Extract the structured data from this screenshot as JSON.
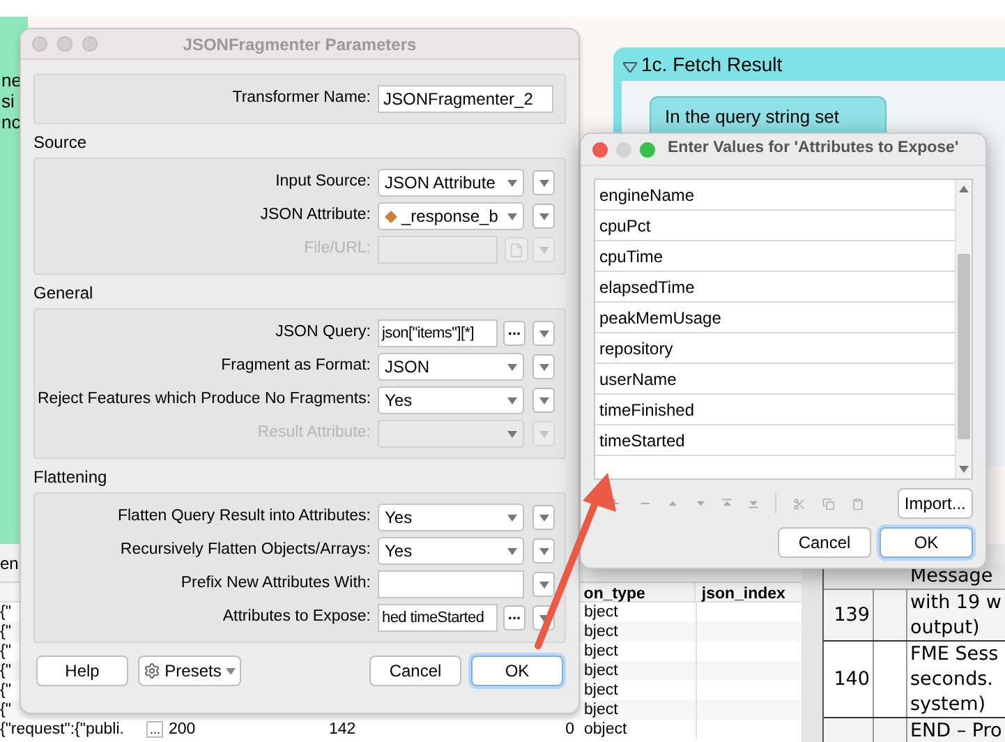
{
  "background": {
    "left_fragments": [
      "ne",
      "si",
      "nc"
    ],
    "bookmark": {
      "title": "1c. Fetch Result",
      "expanded": true,
      "note": "In the query string set"
    },
    "table": {
      "toolbar_fragment": "en",
      "columns": [
        "on_type",
        "json_index"
      ],
      "rows": [
        {
          "column_1": "{\"",
          "json_type": "bject"
        },
        {
          "column_1": "{\"",
          "json_type": "bject"
        },
        {
          "column_1": "{\"",
          "json_type": "bject"
        },
        {
          "column_1": "{\"",
          "json_type": "bject"
        },
        {
          "column_1": "{\"",
          "json_type": "bject"
        },
        {
          "column_1": "{\"",
          "json_type": "bject"
        },
        {
          "column_1": "{\"request\":{\"publi.",
          "more": "...",
          "column_2": "200",
          "column_3": "142",
          "column_4": "0",
          "json_type": "object"
        }
      ]
    },
    "log": {
      "header": "Message",
      "rows": [
        {
          "number": "139",
          "lines": [
            "with 19 w",
            "output)"
          ]
        },
        {
          "number": "140",
          "lines": [
            "FME Sess",
            "seconds.",
            "system)"
          ]
        },
        {
          "lines": [
            "END – Pro"
          ]
        }
      ]
    }
  },
  "parameters_dialog": {
    "title": "JSONFragmenter Parameters",
    "sections": [
      {
        "rows": [
          {
            "label": "Transformer Name:",
            "kind": "input",
            "value": "JSONFragmenter_2",
            "menu": false,
            "disabled": false
          }
        ]
      },
      {
        "heading": "Source",
        "rows": [
          {
            "label": "Input Source:",
            "kind": "select",
            "value": "JSON Attribute",
            "menu": true,
            "disabled": false
          },
          {
            "label": "JSON Attribute:",
            "kind": "attribute-select",
            "value": "_response_b",
            "menu": true,
            "disabled": false
          },
          {
            "label": "File/URL:",
            "kind": "file",
            "menu": true,
            "disabled": true
          }
        ]
      },
      {
        "heading": "General",
        "rows": [
          {
            "label": "JSON Query:",
            "kind": "editor",
            "value": "json[\"items\"][*]",
            "button": "...",
            "menu": true,
            "disabled": false
          },
          {
            "label": "Fragment as Format:",
            "kind": "select",
            "value": "JSON",
            "menu": true,
            "disabled": false
          },
          {
            "label": "Reject Features which Produce No Fragments:",
            "kind": "select",
            "value": "Yes",
            "menu": true,
            "disabled": false
          },
          {
            "label": "Result Attribute:",
            "kind": "select",
            "menu": true,
            "disabled": true
          }
        ]
      },
      {
        "heading": "Flattening",
        "rows": [
          {
            "label": "Flatten Query Result into Attributes:",
            "kind": "select",
            "value": "Yes",
            "menu": true,
            "disabled": false
          },
          {
            "label": "Recursively Flatten Objects/Arrays:",
            "kind": "select",
            "value": "Yes",
            "menu": true,
            "disabled": false
          },
          {
            "label": "Prefix New Attributes With:",
            "kind": "input",
            "menu": true,
            "disabled": false
          },
          {
            "label": "Attributes to Expose:",
            "kind": "editor",
            "value": "hed timeStarted",
            "button": "...",
            "menu": true,
            "disabled": false
          }
        ]
      }
    ],
    "buttons": [
      {
        "label": "Help",
        "kind": "plain",
        "default": false
      },
      {
        "label": "Presets",
        "kind": "presets",
        "default": false
      },
      {
        "label": "Cancel",
        "kind": "plain",
        "default": false
      },
      {
        "label": "OK",
        "kind": "plain",
        "default": true
      }
    ]
  },
  "values_dialog": {
    "title": "Enter Values for 'Attributes to Expose'",
    "items": [
      "engineName",
      "cpuPct",
      "cpuTime",
      "elapsedTime",
      "peakMemUsage",
      "repository",
      "userName",
      "timeFinished",
      "timeStarted"
    ],
    "import_button": "Import...",
    "buttons": [
      {
        "label": "Cancel",
        "default": false
      },
      {
        "label": "OK",
        "default": true
      }
    ]
  }
}
